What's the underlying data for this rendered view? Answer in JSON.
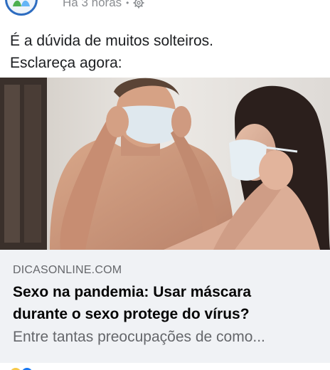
{
  "post": {
    "time_label": "Há 3 horas",
    "separator": "•",
    "privacy_icon": "gear-icon",
    "text_lines": [
      "É a dúvida de muitos solteiros.",
      "Esclareça agora:"
    ]
  },
  "link_preview": {
    "domain": "DICASONLINE.COM",
    "title_lines": [
      "Sexo na pandemia: Usar máscara",
      "durante o sexo protege do vírus?"
    ],
    "description": "Entre tantas preocupações de como..."
  },
  "colors": {
    "meta_gray": "#8a8d91",
    "link_box_bg": "#f0f2f5",
    "avatar_ring": "#2d6cc0"
  }
}
